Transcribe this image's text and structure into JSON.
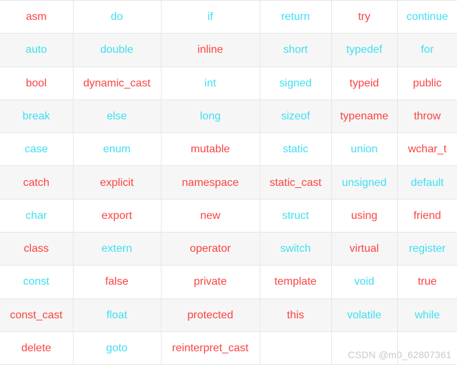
{
  "page": {
    "title": "C++ Keywords Reference Table",
    "columns": 6,
    "rows": 11
  },
  "colors": {
    "red": "#fc4242",
    "cyan": "#3edff2",
    "row_odd_background": "#ffffff",
    "row_even_background": "#f6f6f6",
    "border": "#e6e6e6",
    "watermark": "#c9c9c9"
  },
  "watermark": {
    "text": "CSDN @m0_62807361"
  },
  "table": {
    "rows": [
      {
        "cells": [
          {
            "text": "asm",
            "color": "red"
          },
          {
            "text": "do",
            "color": "cyan"
          },
          {
            "text": "if",
            "color": "cyan"
          },
          {
            "text": "return",
            "color": "cyan"
          },
          {
            "text": "try",
            "color": "red"
          },
          {
            "text": "continue",
            "color": "cyan"
          }
        ]
      },
      {
        "cells": [
          {
            "text": "auto",
            "color": "cyan"
          },
          {
            "text": "double",
            "color": "cyan"
          },
          {
            "text": "inline",
            "color": "red"
          },
          {
            "text": "short",
            "color": "cyan"
          },
          {
            "text": "typedef",
            "color": "cyan"
          },
          {
            "text": "for",
            "color": "cyan"
          }
        ]
      },
      {
        "cells": [
          {
            "text": "bool",
            "color": "red"
          },
          {
            "text": "dynamic_cast",
            "color": "red"
          },
          {
            "text": "int",
            "color": "cyan"
          },
          {
            "text": "signed",
            "color": "cyan"
          },
          {
            "text": "typeid",
            "color": "red"
          },
          {
            "text": "public",
            "color": "red"
          }
        ]
      },
      {
        "cells": [
          {
            "text": "break",
            "color": "cyan"
          },
          {
            "text": "else",
            "color": "cyan"
          },
          {
            "text": "long",
            "color": "cyan"
          },
          {
            "text": "sizeof",
            "color": "cyan"
          },
          {
            "text": "typename",
            "color": "red"
          },
          {
            "text": "throw",
            "color": "red"
          }
        ]
      },
      {
        "cells": [
          {
            "text": "case",
            "color": "cyan"
          },
          {
            "text": "enum",
            "color": "cyan"
          },
          {
            "text": "mutable",
            "color": "red"
          },
          {
            "text": "static",
            "color": "cyan"
          },
          {
            "text": "union",
            "color": "cyan"
          },
          {
            "text": "wchar_t",
            "color": "red"
          }
        ]
      },
      {
        "cells": [
          {
            "text": "catch",
            "color": "red"
          },
          {
            "text": "explicit",
            "color": "red"
          },
          {
            "text": "namespace",
            "color": "red"
          },
          {
            "text": "static_cast",
            "color": "red"
          },
          {
            "text": "unsigned",
            "color": "cyan"
          },
          {
            "text": "default",
            "color": "cyan"
          }
        ]
      },
      {
        "cells": [
          {
            "text": "char",
            "color": "cyan"
          },
          {
            "text": "export",
            "color": "red"
          },
          {
            "text": "new",
            "color": "red"
          },
          {
            "text": "struct",
            "color": "cyan"
          },
          {
            "text": "using",
            "color": "red"
          },
          {
            "text": "friend",
            "color": "red"
          }
        ]
      },
      {
        "cells": [
          {
            "text": "class",
            "color": "red"
          },
          {
            "text": "extern",
            "color": "cyan"
          },
          {
            "text": "operator",
            "color": "red"
          },
          {
            "text": "switch",
            "color": "cyan"
          },
          {
            "text": "virtual",
            "color": "red"
          },
          {
            "text": "register",
            "color": "cyan"
          }
        ]
      },
      {
        "cells": [
          {
            "text": "const",
            "color": "cyan"
          },
          {
            "text": "false",
            "color": "red"
          },
          {
            "text": "private",
            "color": "red"
          },
          {
            "text": "template",
            "color": "red"
          },
          {
            "text": "void",
            "color": "cyan"
          },
          {
            "text": "true",
            "color": "red"
          }
        ]
      },
      {
        "cells": [
          {
            "text": "const_cast",
            "color": "red"
          },
          {
            "text": "float",
            "color": "cyan"
          },
          {
            "text": "protected",
            "color": "red"
          },
          {
            "text": "this",
            "color": "red"
          },
          {
            "text": "volatile",
            "color": "cyan"
          },
          {
            "text": "while",
            "color": "cyan"
          }
        ]
      },
      {
        "cells": [
          {
            "text": "delete",
            "color": "red"
          },
          {
            "text": "goto",
            "color": "cyan"
          },
          {
            "text": "reinterpret_cast",
            "color": "red"
          },
          {
            "text": "",
            "color": "empty"
          },
          {
            "text": "",
            "color": "empty"
          },
          {
            "text": "",
            "color": "empty"
          }
        ]
      }
    ]
  }
}
